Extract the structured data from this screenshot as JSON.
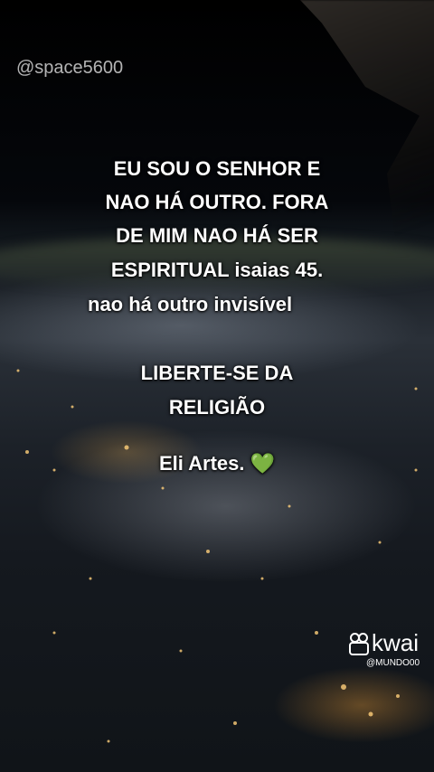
{
  "watermark": "@space5600",
  "caption": {
    "line1": "EU SOU O SENHOR E",
    "line2": "NAO HÁ OUTRO. FORA",
    "line3": "DE MIM NAO HÁ SER",
    "line4": "ESPIRITUAL isaias 45.",
    "line5": "nao há outro invisível",
    "line6": "LIBERTE-SE DA",
    "line7": "RELIGIÃO",
    "line8": "Eli Artes.",
    "heart": "💚"
  },
  "brand": {
    "name": "kwai",
    "handle": "@MUNDO00"
  }
}
